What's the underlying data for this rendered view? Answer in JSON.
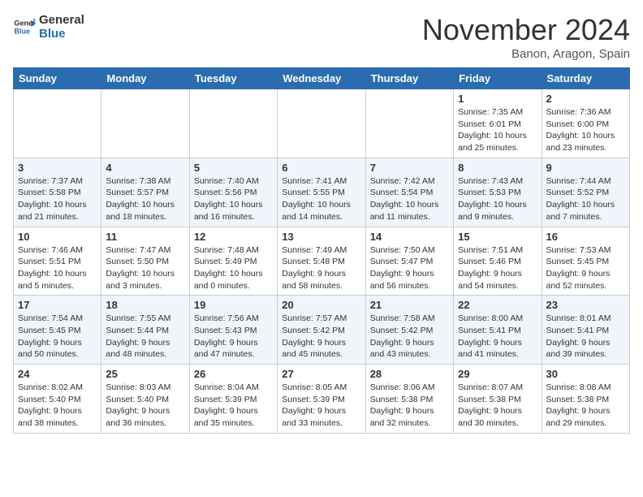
{
  "header": {
    "logo_line1": "General",
    "logo_line2": "Blue",
    "month_title": "November 2024",
    "subtitle": "Banon, Aragon, Spain"
  },
  "weekdays": [
    "Sunday",
    "Monday",
    "Tuesday",
    "Wednesday",
    "Thursday",
    "Friday",
    "Saturday"
  ],
  "weeks": [
    [
      {
        "day": "",
        "info": ""
      },
      {
        "day": "",
        "info": ""
      },
      {
        "day": "",
        "info": ""
      },
      {
        "day": "",
        "info": ""
      },
      {
        "day": "",
        "info": ""
      },
      {
        "day": "1",
        "info": "Sunrise: 7:35 AM\nSunset: 6:01 PM\nDaylight: 10 hours\nand 25 minutes."
      },
      {
        "day": "2",
        "info": "Sunrise: 7:36 AM\nSunset: 6:00 PM\nDaylight: 10 hours\nand 23 minutes."
      }
    ],
    [
      {
        "day": "3",
        "info": "Sunrise: 7:37 AM\nSunset: 5:58 PM\nDaylight: 10 hours\nand 21 minutes."
      },
      {
        "day": "4",
        "info": "Sunrise: 7:38 AM\nSunset: 5:57 PM\nDaylight: 10 hours\nand 18 minutes."
      },
      {
        "day": "5",
        "info": "Sunrise: 7:40 AM\nSunset: 5:56 PM\nDaylight: 10 hours\nand 16 minutes."
      },
      {
        "day": "6",
        "info": "Sunrise: 7:41 AM\nSunset: 5:55 PM\nDaylight: 10 hours\nand 14 minutes."
      },
      {
        "day": "7",
        "info": "Sunrise: 7:42 AM\nSunset: 5:54 PM\nDaylight: 10 hours\nand 11 minutes."
      },
      {
        "day": "8",
        "info": "Sunrise: 7:43 AM\nSunset: 5:53 PM\nDaylight: 10 hours\nand 9 minutes."
      },
      {
        "day": "9",
        "info": "Sunrise: 7:44 AM\nSunset: 5:52 PM\nDaylight: 10 hours\nand 7 minutes."
      }
    ],
    [
      {
        "day": "10",
        "info": "Sunrise: 7:46 AM\nSunset: 5:51 PM\nDaylight: 10 hours\nand 5 minutes."
      },
      {
        "day": "11",
        "info": "Sunrise: 7:47 AM\nSunset: 5:50 PM\nDaylight: 10 hours\nand 3 minutes."
      },
      {
        "day": "12",
        "info": "Sunrise: 7:48 AM\nSunset: 5:49 PM\nDaylight: 10 hours\nand 0 minutes."
      },
      {
        "day": "13",
        "info": "Sunrise: 7:49 AM\nSunset: 5:48 PM\nDaylight: 9 hours\nand 58 minutes."
      },
      {
        "day": "14",
        "info": "Sunrise: 7:50 AM\nSunset: 5:47 PM\nDaylight: 9 hours\nand 56 minutes."
      },
      {
        "day": "15",
        "info": "Sunrise: 7:51 AM\nSunset: 5:46 PM\nDaylight: 9 hours\nand 54 minutes."
      },
      {
        "day": "16",
        "info": "Sunrise: 7:53 AM\nSunset: 5:45 PM\nDaylight: 9 hours\nand 52 minutes."
      }
    ],
    [
      {
        "day": "17",
        "info": "Sunrise: 7:54 AM\nSunset: 5:45 PM\nDaylight: 9 hours\nand 50 minutes."
      },
      {
        "day": "18",
        "info": "Sunrise: 7:55 AM\nSunset: 5:44 PM\nDaylight: 9 hours\nand 48 minutes."
      },
      {
        "day": "19",
        "info": "Sunrise: 7:56 AM\nSunset: 5:43 PM\nDaylight: 9 hours\nand 47 minutes."
      },
      {
        "day": "20",
        "info": "Sunrise: 7:57 AM\nSunset: 5:42 PM\nDaylight: 9 hours\nand 45 minutes."
      },
      {
        "day": "21",
        "info": "Sunrise: 7:58 AM\nSunset: 5:42 PM\nDaylight: 9 hours\nand 43 minutes."
      },
      {
        "day": "22",
        "info": "Sunrise: 8:00 AM\nSunset: 5:41 PM\nDaylight: 9 hours\nand 41 minutes."
      },
      {
        "day": "23",
        "info": "Sunrise: 8:01 AM\nSunset: 5:41 PM\nDaylight: 9 hours\nand 39 minutes."
      }
    ],
    [
      {
        "day": "24",
        "info": "Sunrise: 8:02 AM\nSunset: 5:40 PM\nDaylight: 9 hours\nand 38 minutes."
      },
      {
        "day": "25",
        "info": "Sunrise: 8:03 AM\nSunset: 5:40 PM\nDaylight: 9 hours\nand 36 minutes."
      },
      {
        "day": "26",
        "info": "Sunrise: 8:04 AM\nSunset: 5:39 PM\nDaylight: 9 hours\nand 35 minutes."
      },
      {
        "day": "27",
        "info": "Sunrise: 8:05 AM\nSunset: 5:39 PM\nDaylight: 9 hours\nand 33 minutes."
      },
      {
        "day": "28",
        "info": "Sunrise: 8:06 AM\nSunset: 5:38 PM\nDaylight: 9 hours\nand 32 minutes."
      },
      {
        "day": "29",
        "info": "Sunrise: 8:07 AM\nSunset: 5:38 PM\nDaylight: 9 hours\nand 30 minutes."
      },
      {
        "day": "30",
        "info": "Sunrise: 8:08 AM\nSunset: 5:38 PM\nDaylight: 9 hours\nand 29 minutes."
      }
    ]
  ]
}
